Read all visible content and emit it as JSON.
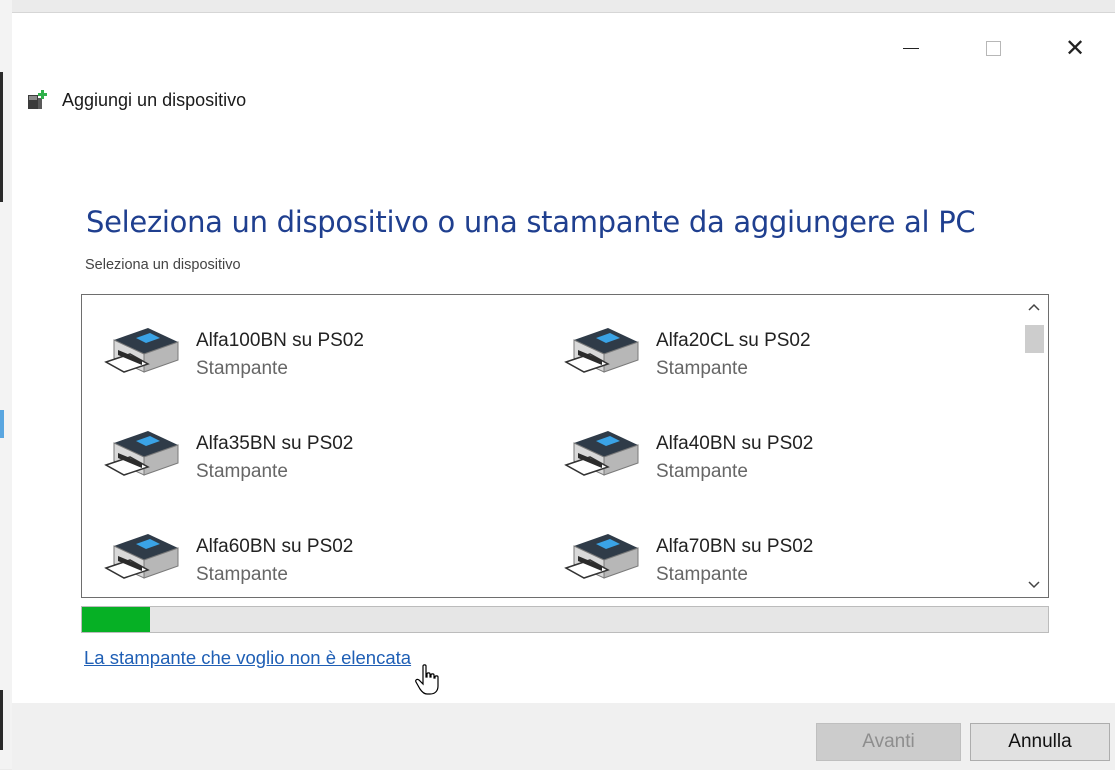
{
  "window": {
    "title": "Aggiungi un dispositivo",
    "minimize_icon": "minimize-icon",
    "maximize_icon": "maximize-icon",
    "close_glyph": "✕"
  },
  "page": {
    "heading": "Seleziona un dispositivo o una stampante da aggiungere al PC",
    "subheading": "Seleziona un dispositivo"
  },
  "devices": [
    {
      "name": "Alfa100BN su PS02",
      "type": "Stampante",
      "icon": "printer-icon"
    },
    {
      "name": "Alfa20CL su PS02",
      "type": "Stampante",
      "icon": "printer-icon"
    },
    {
      "name": "Alfa35BN su PS02",
      "type": "Stampante",
      "icon": "printer-icon"
    },
    {
      "name": "Alfa40BN su PS02",
      "type": "Stampante",
      "icon": "printer-icon"
    },
    {
      "name": "Alfa60BN su PS02",
      "type": "Stampante",
      "icon": "printer-icon"
    },
    {
      "name": "Alfa70BN su PS02",
      "type": "Stampante",
      "icon": "printer-icon"
    }
  ],
  "progress": {
    "value": 0.07,
    "color": "#06b025"
  },
  "link": {
    "text": "La stampante che voglio non è elencata"
  },
  "footer": {
    "next_label": "Avanti",
    "next_enabled": false,
    "cancel_label": "Annulla"
  },
  "colors": {
    "heading": "#1f3f8f",
    "link": "#1f5fb5"
  }
}
